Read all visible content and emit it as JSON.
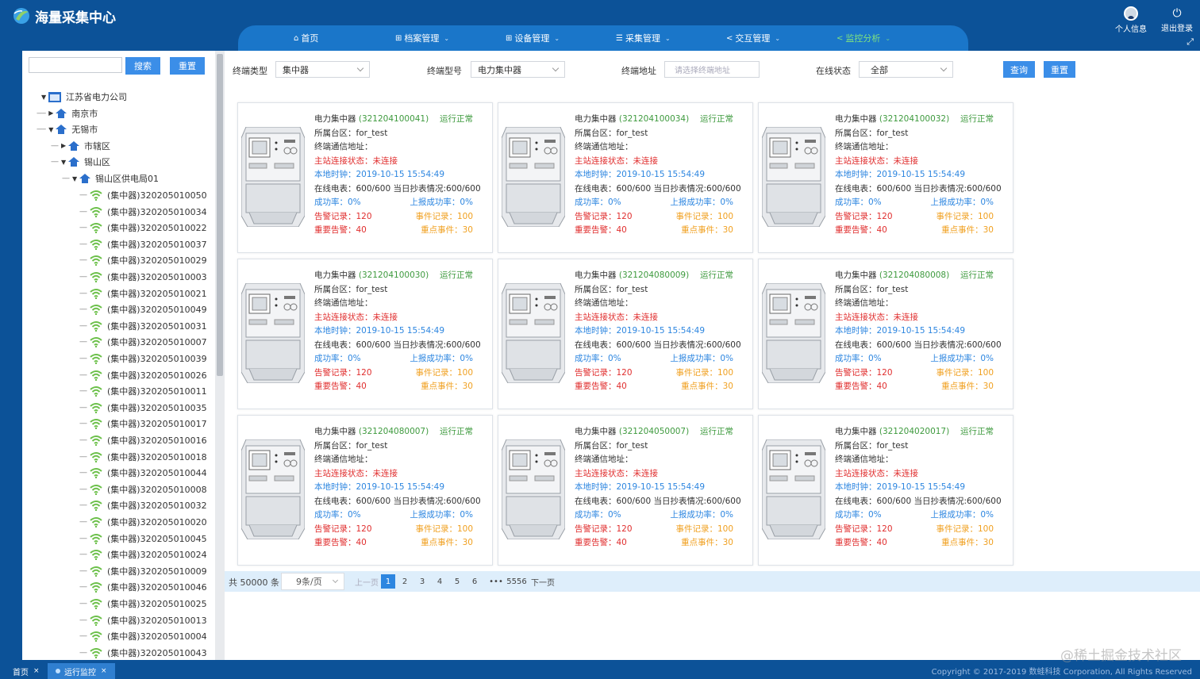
{
  "header": {
    "logo_text": "海量采集中心",
    "nav": [
      {
        "label": "首页",
        "icon": "home-icon"
      },
      {
        "label": "档案管理",
        "icon": "grid-icon"
      },
      {
        "label": "设备管理",
        "icon": "grid-icon"
      },
      {
        "label": "采集管理",
        "icon": "list-icon"
      },
      {
        "label": "交互管理",
        "icon": "share-icon"
      },
      {
        "label": "监控分析",
        "icon": "share-icon"
      }
    ],
    "profile_label": "个人信息",
    "logout_label": "退出登录"
  },
  "sidebar": {
    "search_placeholder": "",
    "search_label": "搜索",
    "reset_label": "重置",
    "tree": [
      {
        "label": "江苏省电力公司",
        "icon": "org-icon",
        "toggle": "▼"
      },
      {
        "label": "南京市",
        "icon": "house-icon",
        "toggle": "▶"
      },
      {
        "label": "无锡市",
        "icon": "house-icon",
        "toggle": "▼"
      },
      {
        "label": "市辖区",
        "icon": "house-icon",
        "toggle": "▶"
      },
      {
        "label": "锡山区",
        "icon": "house-icon",
        "toggle": "▼"
      },
      {
        "label": "锡山区供电局01",
        "icon": "house-icon",
        "toggle": "▼"
      }
    ],
    "leaves": [
      "(集中器)320205010050",
      "(集中器)320205010034",
      "(集中器)320205010022",
      "(集中器)320205010037",
      "(集中器)320205010029",
      "(集中器)320205010003",
      "(集中器)320205010021",
      "(集中器)320205010049",
      "(集中器)320205010031",
      "(集中器)320205010007",
      "(集中器)320205010039",
      "(集中器)320205010026",
      "(集中器)320205010011",
      "(集中器)320205010035",
      "(集中器)320205010017",
      "(集中器)320205010016",
      "(集中器)320205010018",
      "(集中器)320205010044",
      "(集中器)320205010008",
      "(集中器)320205010032",
      "(集中器)320205010020",
      "(集中器)320205010045",
      "(集中器)320205010024",
      "(集中器)320205010009",
      "(集中器)320205010046",
      "(集中器)320205010025",
      "(集中器)320205010013",
      "(集中器)320205010004",
      "(集中器)320205010043"
    ]
  },
  "filters": {
    "type_label": "终端类型",
    "type_value": "集中器",
    "model_label": "终端型号",
    "model_value": "电力集中器",
    "addr_label": "终端地址",
    "addr_placeholder": "请选择终端地址",
    "status_label": "在线状态",
    "status_value": "全部",
    "query_label": "查询",
    "reset_label": "重置"
  },
  "card_labels": {
    "name": "电力集中器",
    "area": "所属台区：",
    "comm_addr": "终端通信地址：",
    "master_link": "主站连接状态：",
    "local_time": "本地时钟：",
    "online_meters": "在线电表：",
    "daily_read": "当日抄表情况:",
    "success_rate": "成功率：",
    "report_rate": "上报成功率：",
    "alarm_records": "告警记录：",
    "event_records": "事件记录：",
    "important_alarms": "重要告警：",
    "key_events": "重点事件："
  },
  "cards": [
    {
      "id": "(321204100041)",
      "status": "运行正常",
      "area": "for_test",
      "comm_addr": "",
      "link": "未连接",
      "time": "2019-10-15 15:54:49",
      "online": "600/600",
      "daily": "600/600",
      "success": "0%",
      "report": "0%",
      "alarms": "120",
      "events": "100",
      "imp_alarms": "40",
      "key_events": "30"
    },
    {
      "id": "(321204100034)",
      "status": "运行正常",
      "area": "for_test",
      "comm_addr": "",
      "link": "未连接",
      "time": "2019-10-15 15:54:49",
      "online": "600/600",
      "daily": "600/600",
      "success": "0%",
      "report": "0%",
      "alarms": "120",
      "events": "100",
      "imp_alarms": "40",
      "key_events": "30"
    },
    {
      "id": "(321204100032)",
      "status": "运行正常",
      "area": "for_test",
      "comm_addr": "",
      "link": "未连接",
      "time": "2019-10-15 15:54:49",
      "online": "600/600",
      "daily": "600/600",
      "success": "0%",
      "report": "0%",
      "alarms": "120",
      "events": "100",
      "imp_alarms": "40",
      "key_events": "30"
    },
    {
      "id": "(321204100030)",
      "status": "运行正常",
      "area": "for_test",
      "comm_addr": "",
      "link": "未连接",
      "time": "2019-10-15 15:54:49",
      "online": "600/600",
      "daily": "600/600",
      "success": "0%",
      "report": "0%",
      "alarms": "120",
      "events": "100",
      "imp_alarms": "40",
      "key_events": "30"
    },
    {
      "id": "(321204080009)",
      "status": "运行正常",
      "area": "for_test",
      "comm_addr": "",
      "link": "未连接",
      "time": "2019-10-15 15:54:49",
      "online": "600/600",
      "daily": "600/600",
      "success": "0%",
      "report": "0%",
      "alarms": "120",
      "events": "100",
      "imp_alarms": "40",
      "key_events": "30"
    },
    {
      "id": "(321204080008)",
      "status": "运行正常",
      "area": "for_test",
      "comm_addr": "",
      "link": "未连接",
      "time": "2019-10-15 15:54:49",
      "online": "600/600",
      "daily": "600/600",
      "success": "0%",
      "report": "0%",
      "alarms": "120",
      "events": "100",
      "imp_alarms": "40",
      "key_events": "30"
    },
    {
      "id": "(321204080007)",
      "status": "运行正常",
      "area": "for_test",
      "comm_addr": "",
      "link": "未连接",
      "time": "2019-10-15 15:54:49",
      "online": "600/600",
      "daily": "600/600",
      "success": "0%",
      "report": "0%",
      "alarms": "120",
      "events": "100",
      "imp_alarms": "40",
      "key_events": "30"
    },
    {
      "id": "(321204050007)",
      "status": "运行正常",
      "area": "for_test",
      "comm_addr": "",
      "link": "未连接",
      "time": "2019-10-15 15:54:49",
      "online": "600/600",
      "daily": "600/600",
      "success": "0%",
      "report": "0%",
      "alarms": "120",
      "events": "100",
      "imp_alarms": "40",
      "key_events": "30"
    },
    {
      "id": "(321204020017)",
      "status": "运行正常",
      "area": "for_test",
      "comm_addr": "",
      "link": "未连接",
      "time": "2019-10-15 15:54:49",
      "online": "600/600",
      "daily": "600/600",
      "success": "0%",
      "report": "0%",
      "alarms": "120",
      "events": "100",
      "imp_alarms": "40",
      "key_events": "30"
    }
  ],
  "pager": {
    "total": "共 50000 条",
    "page_size": "9条/页",
    "prev": "上一页",
    "pages": [
      "1",
      "2",
      "3",
      "4",
      "5",
      "6",
      "•••",
      "5556"
    ],
    "current": "1",
    "next": "下一页"
  },
  "taskbar": {
    "tabs": [
      {
        "label": "首页",
        "active": false
      },
      {
        "label": "运行监控",
        "active": true
      }
    ],
    "copyright": "Copyright © 2017-2019 数蛙科技 Corporation, All Rights Reserved"
  },
  "watermark": "@稀土掘金技术社区",
  "colors": {
    "header_bg": "#0c5298",
    "nav_bg": "#1a76c9",
    "nav_active": "#7fe27f",
    "button": "#3b8ee8",
    "ok_green": "#3e9a3e",
    "alert_red": "#e02e2e",
    "info_blue": "#2d86e0",
    "warn_orange": "#f0a020"
  }
}
